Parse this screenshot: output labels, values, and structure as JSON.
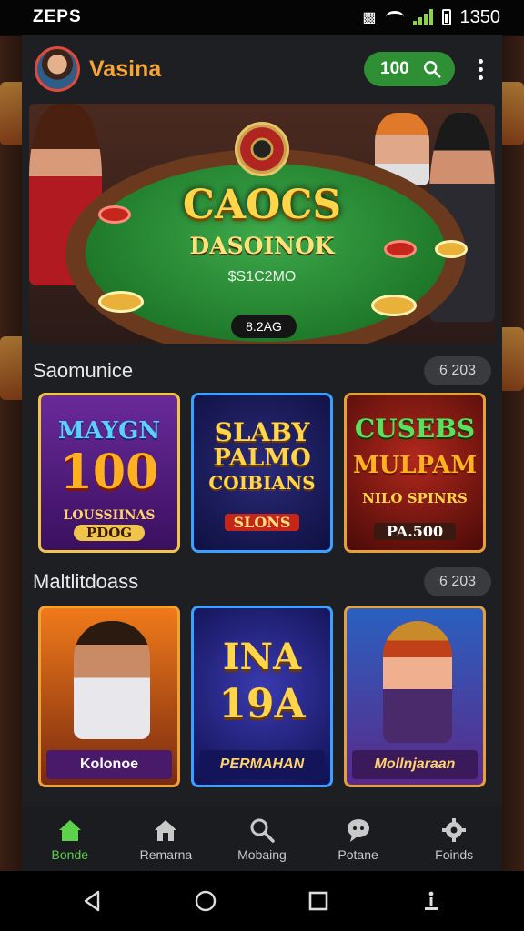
{
  "status_bar": {
    "carrier": "ZEPS",
    "time": "1350"
  },
  "header": {
    "app_name": "Vasina",
    "balance": "100"
  },
  "banner": {
    "title": "CAOCS",
    "subtitle": "DASOINOK",
    "amount": "$S1C2MO",
    "badge": "8.2AG"
  },
  "sections": [
    {
      "title": "Saomunice",
      "count": "6 203",
      "games": [
        {
          "line1": "MAYGN",
          "line2": "100",
          "line3": "LOUSSIINAS",
          "caption": "PDOG"
        },
        {
          "line1": "SLABY",
          "line2": "PALMO",
          "line3": "COIBIANS",
          "caption": "SLONS"
        },
        {
          "line1": "CUSEBS",
          "line2": "MULPAM",
          "line3": "NILO SPINRS",
          "caption": "PA.500"
        }
      ]
    },
    {
      "title": "Maltlitdoass",
      "count": "6 203",
      "games": [
        {
          "caption": "Kolonoe"
        },
        {
          "line1": "INA",
          "line2": "19A",
          "caption": "PERMAHAN"
        },
        {
          "caption": "Mollnjaraan"
        }
      ]
    }
  ],
  "bottom_nav": [
    {
      "label": "Bonde",
      "icon": "home-icon"
    },
    {
      "label": "Remarna",
      "icon": "house-icon"
    },
    {
      "label": "Mobaing",
      "icon": "search-icon"
    },
    {
      "label": "Potane",
      "icon": "chat-icon"
    },
    {
      "label": "Foinds",
      "icon": "gear-icon"
    }
  ],
  "colors": {
    "accent": "#2f8f35",
    "brand": "#f5a43a",
    "active_nav": "#5cd14a"
  }
}
